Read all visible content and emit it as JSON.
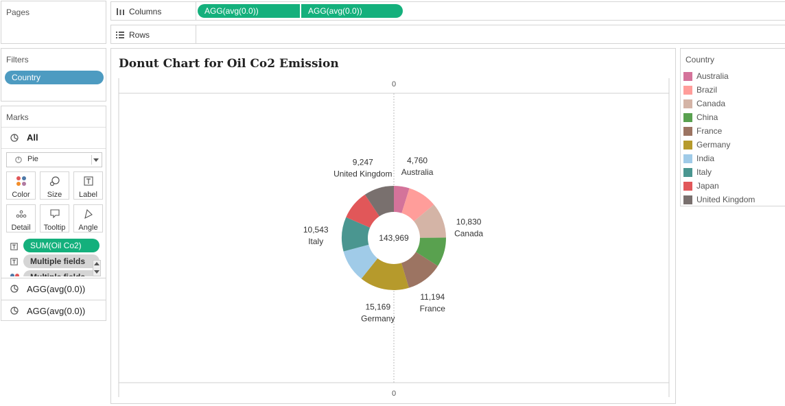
{
  "pages": {
    "title": "Pages"
  },
  "filters": {
    "title": "Filters",
    "pill": "Country"
  },
  "marks": {
    "title": "Marks",
    "all_label": "All",
    "mark_type": "Pie",
    "buttons": {
      "color": "Color",
      "size": "Size",
      "label": "Label",
      "detail": "Detail",
      "tooltip": "Tooltip",
      "angle": "Angle"
    },
    "fields": [
      "SUM(Oil Co2)",
      "Multiple fields",
      "Multiple fields"
    ],
    "cards": [
      "AGG(avg(0.0))",
      "AGG(avg(0.0))"
    ]
  },
  "shelves": {
    "columns_label": "Columns",
    "rows_label": "Rows",
    "column_pills": [
      "AGG(avg(0.0))",
      "AGG(avg(0.0))"
    ]
  },
  "view": {
    "title": "Donut Chart for Oil Co2 Emission",
    "axis_top_label": "0",
    "axis_bottom_label": "0"
  },
  "legend": {
    "title": "Country"
  },
  "chart_data": {
    "type": "pie",
    "title": "Donut Chart for Oil Co2 Emission",
    "total_label": "143,969",
    "slices": [
      {
        "name": "Australia",
        "label": "4,760",
        "value": 4760,
        "color": "#d4739a"
      },
      {
        "name": "Brazil",
        "value": 9000,
        "color": "#ff9d9a"
      },
      {
        "name": "Canada",
        "label": "10,830",
        "value": 10830,
        "color": "#d4b4a6"
      },
      {
        "name": "China",
        "value": 9000,
        "color": "#59a14f"
      },
      {
        "name": "France",
        "label": "11,194",
        "value": 11194,
        "color": "#9c7462"
      },
      {
        "name": "Germany",
        "label": "15,169",
        "value": 15169,
        "color": "#b69a2c"
      },
      {
        "name": "India",
        "value": 10000,
        "color": "#a0cbe8"
      },
      {
        "name": "Italy",
        "label": "10,543",
        "value": 10543,
        "color": "#4a9690"
      },
      {
        "name": "Japan",
        "value": 9000,
        "color": "#e15759"
      },
      {
        "name": "United Kingdom",
        "label": "9,247",
        "value": 9247,
        "color": "#79706e"
      }
    ]
  }
}
